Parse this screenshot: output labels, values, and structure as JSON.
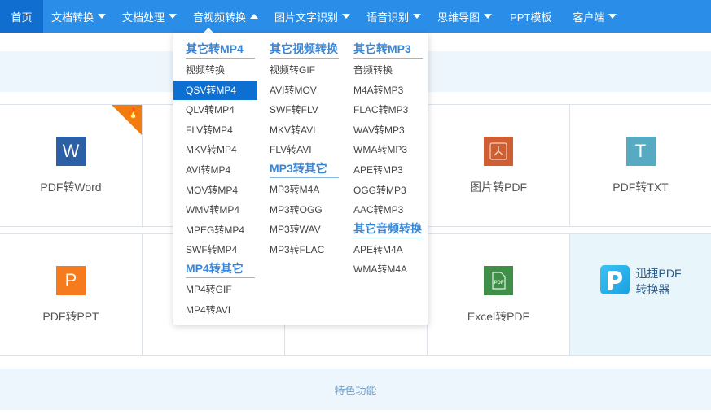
{
  "nav": {
    "items": [
      {
        "label": "首页",
        "caret": "none"
      },
      {
        "label": "文档转换",
        "caret": "down"
      },
      {
        "label": "文档处理",
        "caret": "down"
      },
      {
        "label": "音视频转换",
        "caret": "up"
      },
      {
        "label": "图片文字识别",
        "caret": "down"
      },
      {
        "label": "语音识别",
        "caret": "down"
      },
      {
        "label": "思维导图",
        "caret": "down"
      },
      {
        "label": "PPT模板",
        "caret": "none"
      },
      {
        "label": "客户端",
        "caret": "down"
      }
    ]
  },
  "dropdown": {
    "columns": [
      {
        "sections": [
          {
            "title": "其它转MP4",
            "items": [
              "视频转换",
              "QSV转MP4",
              "QLV转MP4",
              "FLV转MP4",
              "MKV转MP4",
              "AVI转MP4",
              "MOV转MP4",
              "WMV转MP4",
              "MPEG转MP4",
              "SWF转MP4"
            ]
          },
          {
            "title": "MP4转其它",
            "items": [
              "MP4转GIF",
              "MP4转AVI"
            ]
          }
        ]
      },
      {
        "sections": [
          {
            "title": "其它视频转换",
            "items": [
              "视频转GIF",
              "AVI转MOV",
              "SWF转FLV",
              "MKV转AVI",
              "FLV转AVI"
            ]
          },
          {
            "title": "MP3转其它",
            "items": [
              "MP3转M4A",
              "MP3转OGG",
              "MP3转WAV",
              "MP3转FLAC"
            ]
          }
        ]
      },
      {
        "sections": [
          {
            "title": "其它转MP3",
            "items": [
              "音频转换",
              "M4A转MP3",
              "FLAC转MP3",
              "WAV转MP3",
              "WMA转MP3",
              "APE转MP3",
              "OGG转MP3",
              "AAC转MP3"
            ]
          },
          {
            "title": "其它音频转换",
            "items": [
              "APE转M4A",
              "WMA转M4A"
            ]
          }
        ]
      }
    ],
    "highlighted_item": "QSV转MP4"
  },
  "tiles": {
    "row1": [
      {
        "label": "PDF转Word",
        "icon": "word-icon",
        "glyph": "W",
        "color": "#2b5fa6",
        "hot": true
      },
      {
        "label": "",
        "icon": "",
        "glyph": "",
        "color": ""
      },
      {
        "label": "",
        "icon": "",
        "glyph": "",
        "color": ""
      },
      {
        "label": "图片转PDF",
        "icon": "pdf-acrobat-icon",
        "glyph": "⅄",
        "color": "#cf5f33"
      },
      {
        "label": "PDF转TXT",
        "icon": "txt-icon",
        "glyph": "T",
        "color": "#56aac2"
      }
    ],
    "row2": [
      {
        "label": "PDF转PPT",
        "icon": "ppt-icon",
        "glyph": "P",
        "color": "#f57b1c"
      },
      {
        "label": "",
        "icon": "",
        "glyph": "",
        "color": ""
      },
      {
        "label": "",
        "icon": "",
        "glyph": "",
        "color": ""
      },
      {
        "label": "Excel转PDF",
        "icon": "excel-pdf-icon",
        "glyph": "PDF",
        "color": "#3f8f48"
      }
    ],
    "promo": {
      "line1": "迅捷PDF",
      "line2": "转换器"
    }
  },
  "feature": {
    "label": "特色功能"
  },
  "colors": {
    "nav_bg": "#2a8ee8",
    "nav_active": "#0f6ecf",
    "accent": "#3a86d6",
    "highlight": "#0d6fd1"
  }
}
